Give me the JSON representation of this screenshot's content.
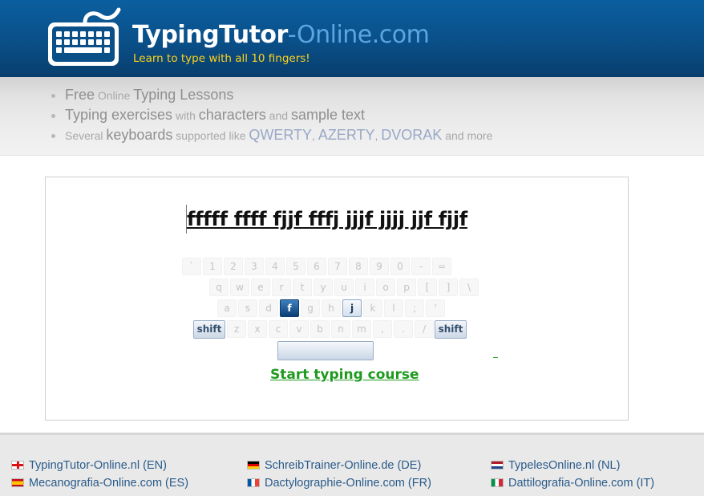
{
  "header": {
    "brand_main": "TypingTutor",
    "brand_dash": "-",
    "brand_suffix": "Online.com",
    "tagline": "Learn to type with all 10 fingers!",
    "logo_icon": "keyboard-icon"
  },
  "features": [
    {
      "parts": [
        [
          "hl",
          "Free"
        ],
        [
          "",
          " Online "
        ],
        [
          "hl",
          "Typing Lessons"
        ]
      ]
    },
    {
      "parts": [
        [
          "hl",
          "Typing exercises"
        ],
        [
          "",
          " with "
        ],
        [
          "hl",
          "characters"
        ],
        [
          "",
          " and "
        ],
        [
          "hl",
          "sample text"
        ]
      ]
    },
    {
      "parts": [
        [
          "",
          "Several "
        ],
        [
          "hl",
          "keyboards"
        ],
        [
          "",
          " supported like "
        ],
        [
          "hl-blue",
          "QWERTY"
        ],
        [
          "",
          ", "
        ],
        [
          "hl-blue",
          "AZERTY"
        ],
        [
          "",
          ", "
        ],
        [
          "hl-blue",
          "DVORAK"
        ],
        [
          "",
          " and more"
        ]
      ]
    }
  ],
  "exercise": {
    "text": "fffff ffff fjjf fffj jjjf jjjj jjf fjjf"
  },
  "keyboard": {
    "row1": [
      "`",
      "1",
      "2",
      "3",
      "4",
      "5",
      "6",
      "7",
      "8",
      "9",
      "0",
      "-",
      "="
    ],
    "row2": [
      "q",
      "w",
      "e",
      "r",
      "t",
      "y",
      "u",
      "i",
      "o",
      "p",
      "[",
      "]",
      "\\"
    ],
    "row3": [
      "a",
      "s",
      "d",
      "f",
      "g",
      "h",
      "j",
      "k",
      "l",
      ";",
      "'"
    ],
    "row4": [
      "z",
      "x",
      "c",
      "v",
      "b",
      "n",
      "m",
      ",",
      ".",
      "/"
    ],
    "shift_label": "shift",
    "active_key": "f",
    "next_key": "j"
  },
  "start_link": "Start typing course",
  "footer": {
    "links": [
      {
        "flag": "en",
        "label": "TypingTutor-Online.nl (EN)"
      },
      {
        "flag": "de",
        "label": "SchreibTrainer-Online.de (DE)"
      },
      {
        "flag": "nl",
        "label": "TypelesOnline.nl (NL)"
      },
      {
        "flag": "es",
        "label": "Mecanografia-Online.com (ES)"
      },
      {
        "flag": "fr",
        "label": "Dactylographie-Online.com (FR)"
      },
      {
        "flag": "it",
        "label": "Dattilografia-Online.com (IT)"
      }
    ]
  },
  "colors": {
    "header_bg": "#0a4f88",
    "tagline": "#ffd21a",
    "brand_suffix": "#5aa6e3",
    "active_key": "#0c3f73",
    "start_link": "#1f9a1f",
    "footer_link": "#2a5b8a"
  }
}
